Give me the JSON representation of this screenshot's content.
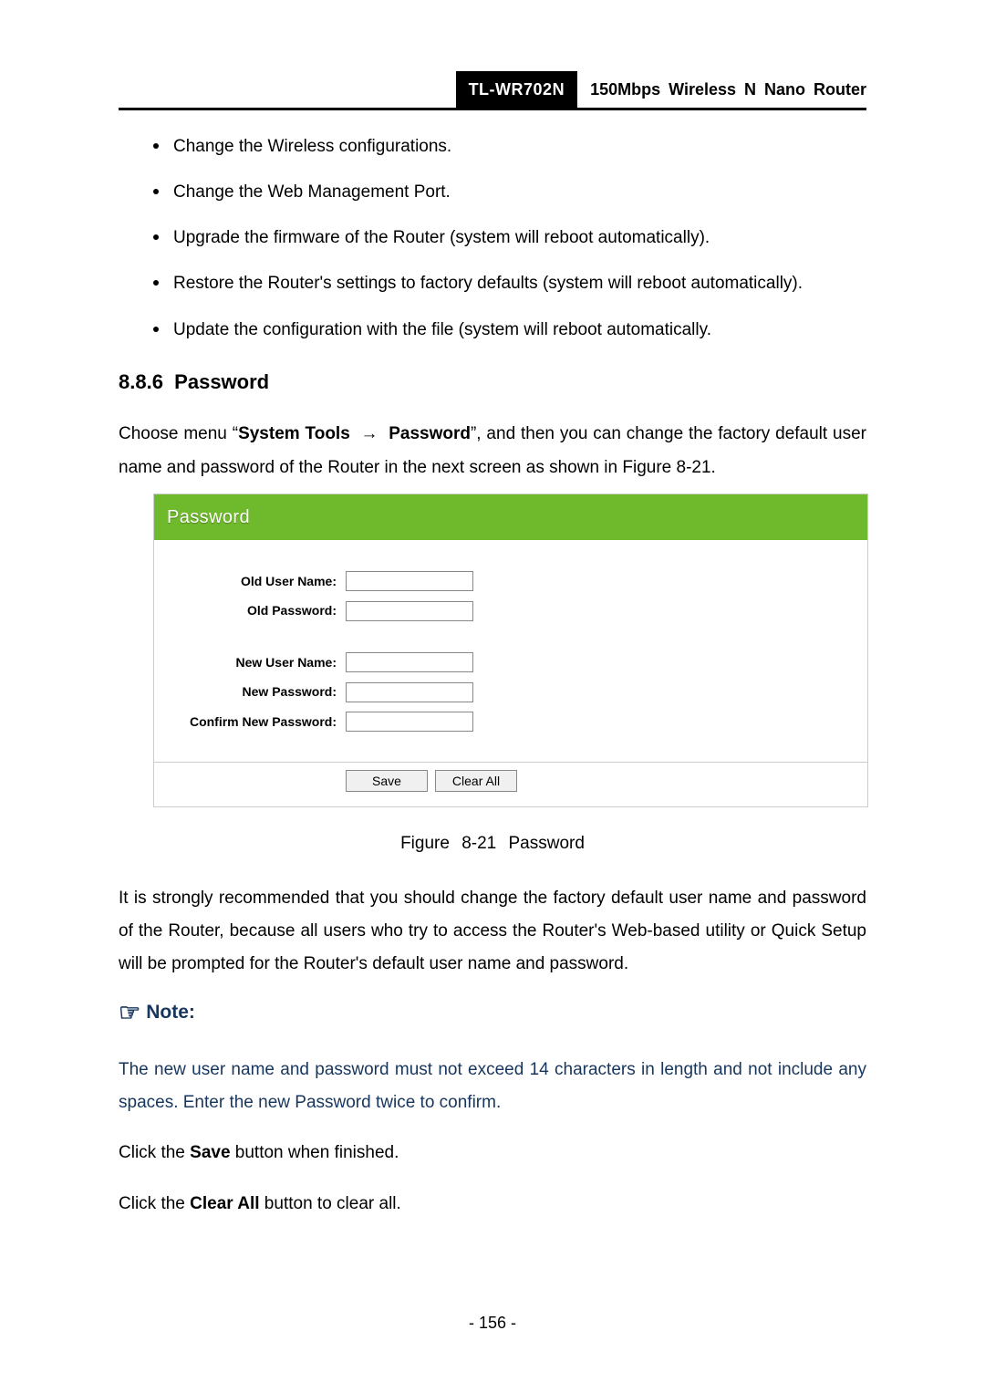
{
  "header": {
    "model": "TL-WR702N",
    "description": "150Mbps Wireless N Nano Router"
  },
  "bullets": [
    "Change the Wireless configurations.",
    "Change the Web Management Port.",
    "Upgrade the firmware of the Router (system will reboot automatically).",
    "Restore the Router's settings to factory defaults (system will reboot automatically).",
    "Update the configuration with the file (system will reboot automatically."
  ],
  "section": {
    "number": "8.8.6",
    "title": "Password"
  },
  "intro": {
    "pre": "Choose menu “",
    "menu1": "System Tools",
    "arrow": "→",
    "menu2": "Password",
    "post": "”, and then you can change the factory default user name and password of the Router in the next screen as shown in Figure 8-21."
  },
  "figure": {
    "panel_title": "Password",
    "labels": {
      "old_user": "Old User Name:",
      "old_pass": "Old Password:",
      "new_user": "New User Name:",
      "new_pass": "New Password:",
      "confirm_pass": "Confirm New Password:"
    },
    "buttons": {
      "save": "Save",
      "clear": "Clear All"
    },
    "caption": "Figure 8-21   Password"
  },
  "recommend": "It is strongly recommended that you should change the factory default user name and password of the Router, because all users who try to access the Router's Web-based utility or Quick Setup will be prompted for the Router's default user name and password.",
  "note": {
    "heading": "Note:",
    "body": "The new user name and password must not exceed 14 characters in length and not include any spaces. Enter the new Password twice to confirm."
  },
  "clicks": {
    "save_pre": "Click the ",
    "save_bold": "Save",
    "save_post": " button when finished.",
    "clear_pre": "Click the ",
    "clear_bold": "Clear All",
    "clear_post": " button to clear all."
  },
  "page_number": "- 156 -"
}
